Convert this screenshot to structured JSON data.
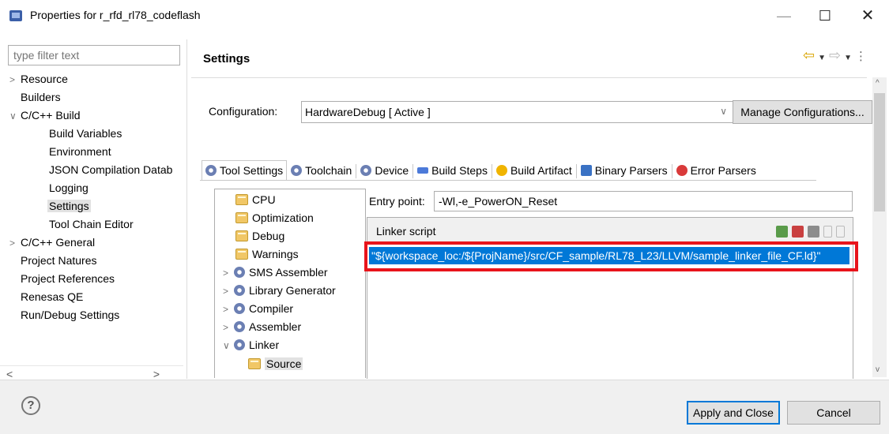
{
  "window": {
    "title": "Properties for r_rfd_rl78_codeflash",
    "minimize": "—",
    "maximize": "☐",
    "close": "✕"
  },
  "sidebar": {
    "filter_placeholder": "type filter text",
    "items": [
      {
        "label": "Resource",
        "arrow": ">",
        "level": 0
      },
      {
        "label": "Builders",
        "arrow": "",
        "level": 0
      },
      {
        "label": "C/C++ Build",
        "arrow": "∨",
        "level": 0
      },
      {
        "label": "Build Variables",
        "arrow": "",
        "level": 1
      },
      {
        "label": "Environment",
        "arrow": "",
        "level": 1
      },
      {
        "label": "JSON Compilation Datab",
        "arrow": "",
        "level": 1
      },
      {
        "label": "Logging",
        "arrow": "",
        "level": 1
      },
      {
        "label": "Settings",
        "arrow": "",
        "level": 1,
        "selected": true
      },
      {
        "label": "Tool Chain Editor",
        "arrow": "",
        "level": 1
      },
      {
        "label": "C/C++ General",
        "arrow": ">",
        "level": 0
      },
      {
        "label": "Project Natures",
        "arrow": "",
        "level": 0
      },
      {
        "label": "Project References",
        "arrow": "",
        "level": 0
      },
      {
        "label": "Renesas QE",
        "arrow": "",
        "level": 0
      },
      {
        "label": "Run/Debug Settings",
        "arrow": "",
        "level": 0
      }
    ],
    "scroll_left": "<",
    "scroll_right": ">"
  },
  "header": {
    "title": "Settings"
  },
  "configuration": {
    "label": "Configuration:",
    "value": "HardwareDebug  [ Active ]",
    "manage_label": "Manage Configurations..."
  },
  "tabs": [
    {
      "label": "Tool Settings",
      "icon": "gear-icon",
      "active": true
    },
    {
      "label": "Toolchain",
      "icon": "gear-icon"
    },
    {
      "label": "Device",
      "icon": "gear-icon"
    },
    {
      "label": "Build Steps",
      "icon": "build-steps-icon"
    },
    {
      "label": "Build Artifact",
      "icon": "artifact-icon"
    },
    {
      "label": "Binary Parsers",
      "icon": "binary-icon"
    },
    {
      "label": "Error Parsers",
      "icon": "error-icon"
    }
  ],
  "tool_tree": [
    {
      "label": "CPU",
      "icon": "folder-icon",
      "arrow": ""
    },
    {
      "label": "Optimization",
      "icon": "folder-icon",
      "arrow": ""
    },
    {
      "label": "Debug",
      "icon": "folder-icon",
      "arrow": ""
    },
    {
      "label": "Warnings",
      "icon": "folder-icon",
      "arrow": ""
    },
    {
      "label": "SMS Assembler",
      "icon": "gear-icon",
      "arrow": ">"
    },
    {
      "label": "Library Generator",
      "icon": "gear-icon",
      "arrow": ">"
    },
    {
      "label": "Compiler",
      "icon": "gear-icon",
      "arrow": ">"
    },
    {
      "label": "Assembler",
      "icon": "gear-icon",
      "arrow": ">"
    },
    {
      "label": "Linker",
      "icon": "gear-icon",
      "arrow": "∨"
    },
    {
      "label": "Source",
      "icon": "folder-icon",
      "arrow": "",
      "selected": true
    }
  ],
  "entry_point": {
    "label": "Entry point:",
    "value": "-Wl,-e_PowerON_Reset"
  },
  "linker_script": {
    "title": "Linker script",
    "entries": [
      "\"${workspace_loc:/${ProjName}/src/CF_sample/RL78_L23/LLVM/sample_linker_file_CF.ld}\""
    ]
  },
  "footer": {
    "help": "?",
    "apply_label": "Apply and Close",
    "cancel_label": "Cancel"
  },
  "colors": {
    "selection": "#0078d7",
    "highlight_border": "#e8141b"
  }
}
